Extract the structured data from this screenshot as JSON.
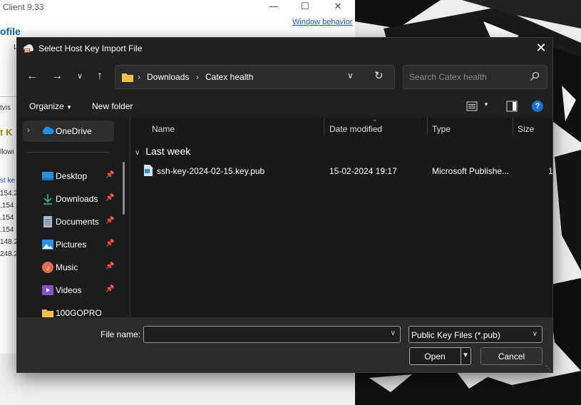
{
  "background_window": {
    "title": "Client 9.33",
    "profile_fragment": "ofile",
    "window_behavior_link": "Window behavior",
    "fragments": [
      "L",
      "tvis",
      "t K",
      "llowi",
      "st ke",
      "154.2",
      ".154",
      ".154",
      ".154",
      "148.2",
      "248.2"
    ]
  },
  "dialog": {
    "title": "Select Host Key Import File",
    "breadcrumb": [
      "Downloads",
      "Catex health"
    ],
    "search_placeholder": "Search Catex health",
    "toolbar": {
      "organize": "Organize",
      "new_folder": "New folder"
    },
    "sidebar": {
      "onedrive": "OneDrive",
      "items": [
        {
          "label": "Desktop",
          "icon": "desktop-icon",
          "pinned": true
        },
        {
          "label": "Downloads",
          "icon": "download-icon",
          "pinned": true
        },
        {
          "label": "Documents",
          "icon": "documents-icon",
          "pinned": true
        },
        {
          "label": "Pictures",
          "icon": "pictures-icon",
          "pinned": true
        },
        {
          "label": "Music",
          "icon": "music-icon",
          "pinned": true
        },
        {
          "label": "Videos",
          "icon": "videos-icon",
          "pinned": true
        },
        {
          "label": "100GOPRO",
          "icon": "folder-icon",
          "pinned": false
        }
      ]
    },
    "columns": {
      "name": "Name",
      "date_modified": "Date modified",
      "type": "Type",
      "size": "Size"
    },
    "group": "Last week",
    "files": [
      {
        "name": "ssh-key-2024-02-15.key.pub",
        "date": "15-02-2024 19:17",
        "type": "Microsoft Publishe...",
        "size": "1"
      }
    ],
    "bottom": {
      "file_name_label": "File name:",
      "file_name_value": "",
      "filter": "Public Key Files (*.pub)",
      "open": "Open",
      "cancel": "Cancel"
    }
  },
  "colors": {
    "accent": "#1f6fd1",
    "dialog_bg": "#202020",
    "folder": "#f0c14a"
  }
}
